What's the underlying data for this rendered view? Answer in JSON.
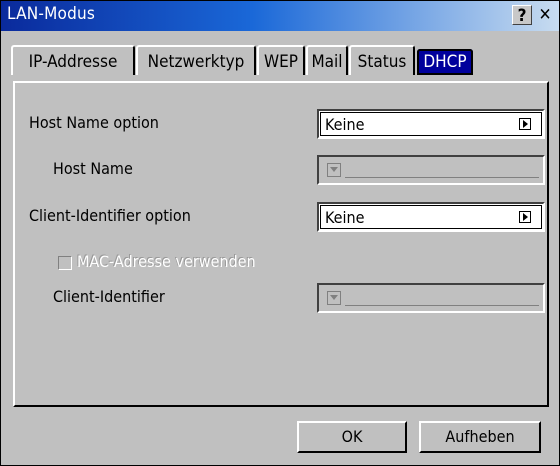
{
  "window": {
    "title": "LAN-Modus",
    "help_label": "?",
    "close_label": "✕"
  },
  "tabs": [
    {
      "label": "IP-Addresse"
    },
    {
      "label": "Netzwerktyp"
    },
    {
      "label": "WEP"
    },
    {
      "label": "Mail"
    },
    {
      "label": "Status"
    },
    {
      "label": "DHCP"
    }
  ],
  "active_tab": "DHCP",
  "form": {
    "host_name_option_label": "Host Name option",
    "host_name_option_value": "Keine",
    "host_name_label": "Host Name",
    "host_name_value": "",
    "client_identifier_option_label": "Client-Identifier option",
    "client_identifier_option_value": "Keine",
    "mac_checkbox_label": "MAC-Adresse verwenden",
    "mac_checkbox_checked": false,
    "client_identifier_label": "Client-Identifier",
    "client_identifier_value": ""
  },
  "buttons": {
    "ok": "OK",
    "cancel": "Aufheben"
  }
}
